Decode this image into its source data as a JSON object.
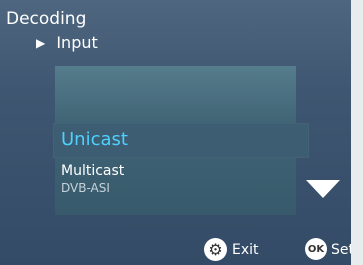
{
  "header": {
    "title": "Decoding",
    "breadcrumb": "Input",
    "breadcrumb_icon": "play-arrow-icon"
  },
  "menu": {
    "selected_index": 0,
    "items": [
      {
        "label": "Unicast",
        "selected": true
      },
      {
        "label": "Multicast",
        "selected": false
      },
      {
        "label": "DVB-ASI",
        "selected": false
      }
    ],
    "scroll_icon": "chevron-down-icon"
  },
  "footer": {
    "exit_label": "Exit",
    "exit_icon": "gear-icon",
    "set_label": "Set",
    "ok_icon_text": "OK"
  },
  "colors": {
    "selected_text": "#50d0ff",
    "background": "#3e5671"
  }
}
